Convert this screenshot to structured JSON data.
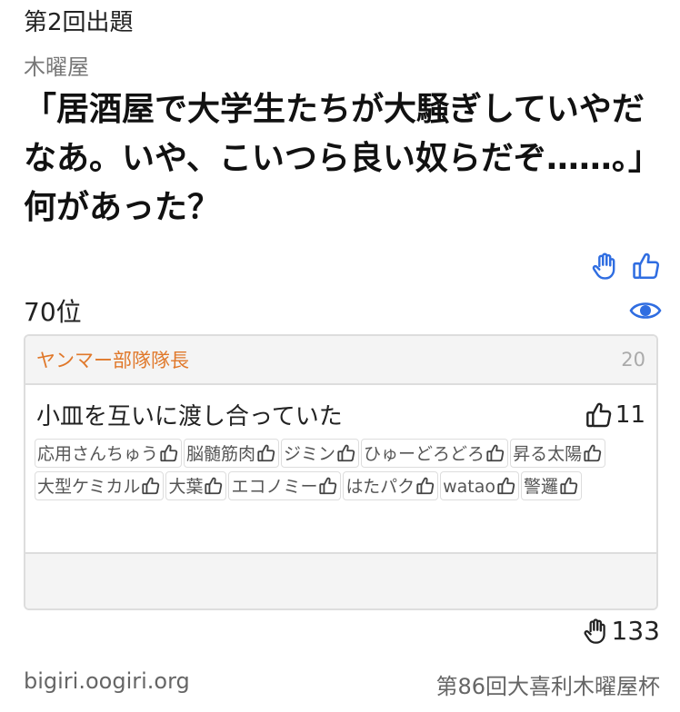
{
  "round_title": "第2回出題",
  "author": "木曜屋",
  "question": "「居酒屋で大学生たちが大騒ぎしていやだなあ。いや、こいつら良い奴らだぞ……。」何があった？",
  "actions": {
    "hand_icon": "hand-icon",
    "like_icon": "thumbs-up-icon",
    "accent_color": "#2f6de1"
  },
  "rank": "70位",
  "card": {
    "team": "ヤンマー部隊隊長",
    "count": "20",
    "answer": "小皿を互いに渡し合っていた",
    "likes": "11",
    "voters": [
      {
        "name": "応用さんちゅう"
      },
      {
        "name": "脳髄筋肉"
      },
      {
        "name": "ジミン"
      },
      {
        "name": "ひゅーどろどろ"
      },
      {
        "name": "昇る太陽"
      },
      {
        "name": "大型ケミカル"
      },
      {
        "name": "大葉"
      },
      {
        "name": "エコノミー"
      },
      {
        "name": "はたパク"
      },
      {
        "name": "watao"
      },
      {
        "name": "警邏"
      }
    ]
  },
  "hand_count": "133",
  "footer": {
    "site": "bigiri.oogiri.org",
    "event": "第86回大喜利木曜屋杯"
  }
}
